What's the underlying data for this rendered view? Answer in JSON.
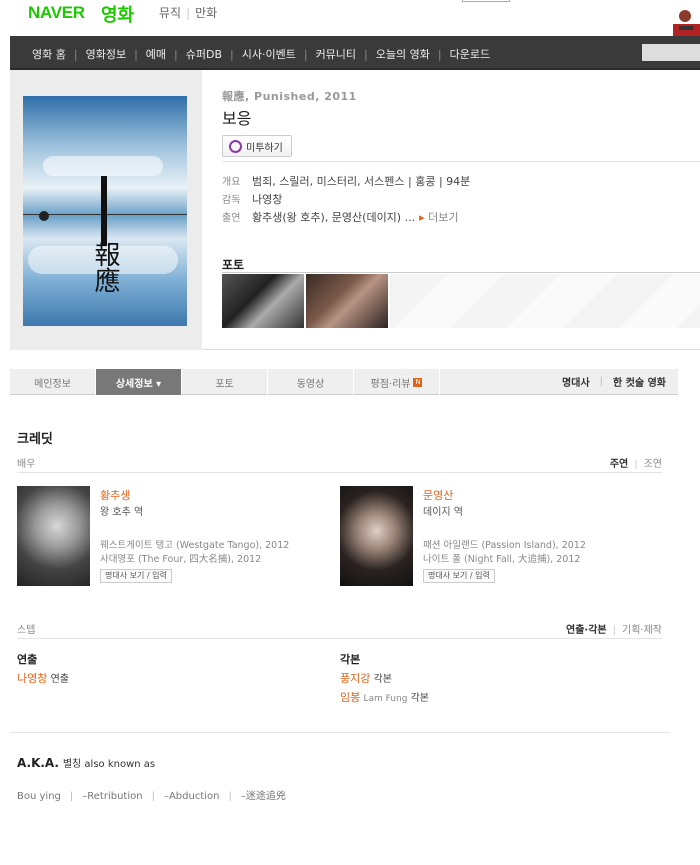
{
  "header": {
    "logo": "NAVER",
    "logo_sub": "영화",
    "links": [
      "뮤직",
      "만화"
    ]
  },
  "nav": {
    "items": [
      "영화 홈",
      "영화정보",
      "예매",
      "슈퍼DB",
      "시사·이벤트",
      "커뮤니티",
      "오늘의 영화",
      "다운로드"
    ]
  },
  "movie": {
    "original": "報應, Punished, 2011",
    "title": "보응",
    "mitu_label": "미투하기",
    "overview_label": "개요",
    "overview": "범죄, 스릴러, 미스터리, 서스펜스 | 홍콩 | 94분",
    "director_label": "감독",
    "director": "나영창",
    "cast_label": "출연",
    "cast": "황추생(왕 호추), 문영산(데이지) ...",
    "more": "더보기",
    "photo_label": "포토",
    "poster_glyphs": "報應"
  },
  "tabs": {
    "items": [
      "메인정보",
      "상세정보 ▾",
      "포토",
      "동영상",
      "평점·리뷰"
    ],
    "active_index": 1,
    "new_badge": "N",
    "right": [
      "명대사",
      "한 컷술 영화"
    ]
  },
  "credit": {
    "title": "크레딧",
    "actors_label": "배우",
    "actors_tabs": [
      "주연",
      "조연"
    ],
    "actors": [
      {
        "name": "황추생",
        "role": "왕 호추 역",
        "films": [
          "웨스트게이트 탱고 (Westgate Tango), 2012",
          "사대명포 (The Four, 四大名捕), 2012"
        ],
        "button": "명대사 보기 / 입력"
      },
      {
        "name": "문영산",
        "role": "데이지 역",
        "films": [
          "패션 아일랜드 (Passion Island), 2012",
          "나이트 폴 (Night Fall, 大追捕), 2012"
        ],
        "button": "명대사 보기 / 입력"
      }
    ],
    "staff_label": "스텝",
    "staff_tabs": [
      "연출·각본",
      "기획·제작"
    ],
    "directing": {
      "head": "연출",
      "name": "나영창",
      "role": "연출"
    },
    "writing": {
      "head": "각본",
      "people": [
        {
          "name": "풍지강",
          "en": "",
          "role": "각본"
        },
        {
          "name": "임봉",
          "en": "Lam Fung",
          "role": "각본"
        }
      ]
    }
  },
  "aka": {
    "title_bold": "A.K.A.",
    "title_rest": "별칭 also known as",
    "items": [
      "Bou ying",
      "–Retribution",
      "–Abduction",
      "–迷途追兇"
    ]
  }
}
